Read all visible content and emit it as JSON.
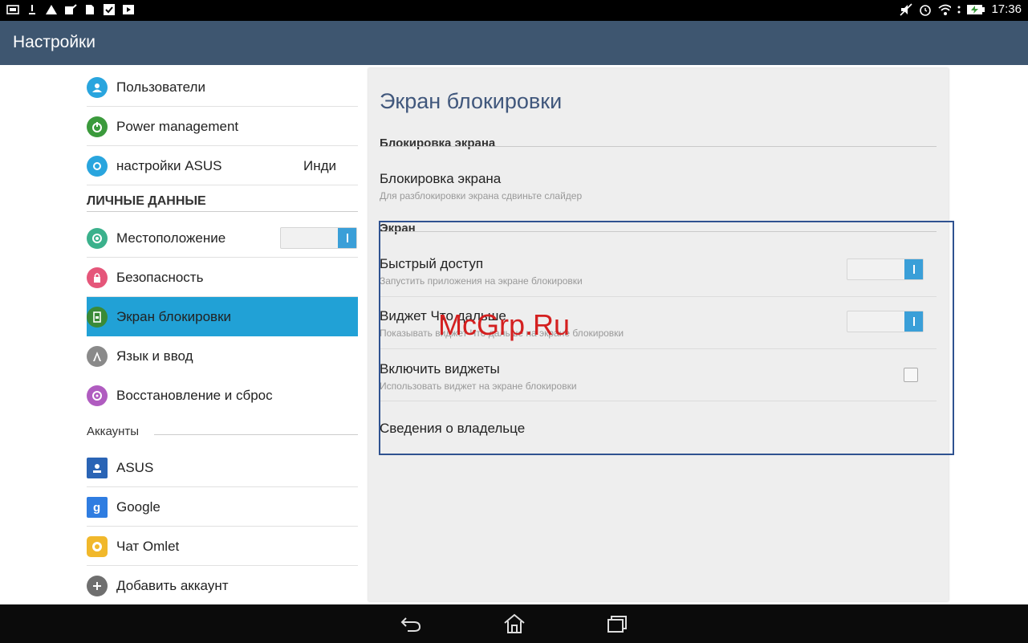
{
  "status_bar": {
    "left_icons": [
      "gallery-icon",
      "download-icon",
      "warning-icon",
      "edit-icon",
      "file-icon",
      "check-icon",
      "play-icon"
    ],
    "right_icons": [
      "mute-icon",
      "alarm-icon",
      "wifi-icon",
      "menu-dots-icon",
      "battery-charging-icon"
    ],
    "time": "17:36"
  },
  "action_bar": {
    "title": "Настройки"
  },
  "left_menu": {
    "items": [
      {
        "label": "Пользователи",
        "icon": "user-icon",
        "color": "#29a5de"
      },
      {
        "label": "Power management",
        "icon": "power-icon",
        "color": "#3b9a3c"
      },
      {
        "label": "настройки ASUS",
        "icon": "asus-settings-icon",
        "color": "#29a5de",
        "extra": "Инди"
      }
    ],
    "section_personal": "ЛИЧНЫЕ ДАННЫЕ",
    "personal_items": [
      {
        "label": "Местоположение",
        "icon": "location-icon",
        "color": "#3bb18c",
        "toggle": true
      },
      {
        "label": "Безопасность",
        "icon": "lock-icon",
        "color": "#e5567a"
      },
      {
        "label": "Экран блокировки",
        "icon": "lockscreen-icon",
        "color": "#3a8a37",
        "active": true
      },
      {
        "label": "Язык и ввод",
        "icon": "language-icon",
        "color": "#8a8a8a"
      },
      {
        "label": "Восстановление и сброс",
        "icon": "restore-icon",
        "color": "#b05cc0"
      }
    ],
    "section_accounts": "Аккаунты",
    "account_items": [
      {
        "label": "ASUS",
        "icon": "asus-account-icon",
        "color": "#2a64b5"
      },
      {
        "label": "Google",
        "icon": "google-icon",
        "color": "#2f7de1"
      },
      {
        "label": "Чат Omlet",
        "icon": "omlet-icon",
        "color": "#f1b82b"
      },
      {
        "label": "Добавить аккаунт",
        "icon": "add-icon",
        "color": "#6f6f6f"
      }
    ]
  },
  "panel": {
    "title": "Экран блокировки",
    "category_lock": "Блокировка экрана",
    "lock_item": {
      "title": "Блокировка экрана",
      "subtitle": "Для разблокировки экрана сдвиньте слайдер"
    },
    "category_screen": "Экран",
    "quick_access": {
      "title": "Быстрый доступ",
      "subtitle": "Запустить приложения на экране блокировки",
      "enabled": true
    },
    "widget_whats_next": {
      "title": "Виджет Что дальше",
      "subtitle": "Показывать виджет Что дальше на экране блокировки",
      "enabled": true
    },
    "enable_widgets": {
      "title": "Включить виджеты",
      "subtitle": "Использовать виджет на экране блокировки",
      "checked": false
    },
    "owner_info": {
      "title": "Сведения о владельце"
    }
  },
  "watermark": "McGrp.Ru",
  "nav_bar": {
    "icons": [
      "back-icon",
      "home-icon",
      "recents-icon"
    ]
  }
}
